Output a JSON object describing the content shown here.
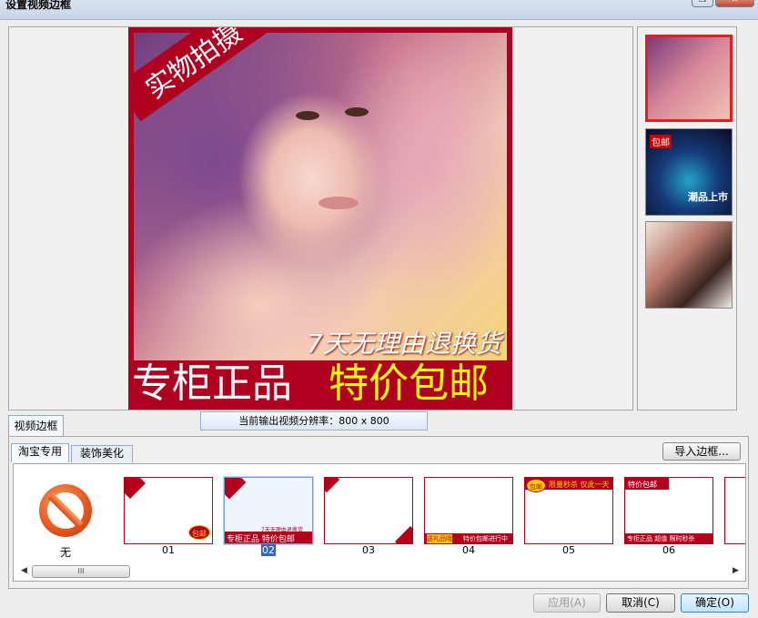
{
  "window": {
    "title": "设置视频边框",
    "restore_symbol": "❐",
    "close_symbol": "✕"
  },
  "preview": {
    "corner_tag": "实物拍摄",
    "slogan": "7天无理由退换货",
    "bar_left": "专柜正品",
    "bar_right": "特价包邮",
    "resolution_text": "当前输出视频分辨率：800 x 800",
    "frame_color": "#b0001f",
    "highlight_color": "#ffff00"
  },
  "thumbnails": {
    "items": [
      {
        "name": "thumb-1",
        "caption": ""
      },
      {
        "name": "thumb-2",
        "caption": "包邮"
      },
      {
        "name": "thumb-3",
        "caption": ""
      }
    ],
    "thumb2_overlay": "潮品上市"
  },
  "tabs": {
    "main": "视频边框",
    "sub": [
      "淘宝专用",
      "装饰美化"
    ]
  },
  "import_button": "导入边框...",
  "frames": {
    "none_label": "无",
    "items": [
      {
        "label": "01"
      },
      {
        "label": "02",
        "selected": true
      },
      {
        "label": "03"
      },
      {
        "label": "04"
      },
      {
        "label": "05"
      },
      {
        "label": "06"
      }
    ],
    "f02_bottom": "专柜正品 特价包邮",
    "f02_slogan": "7天无理由退换货",
    "f04_left": "送礼品哦",
    "f04_right": "特价包邮进行中",
    "f05_top": "限量秒杀 仅此一天",
    "f05_badge": "包邮",
    "f06_top": "特价包邮",
    "f06_bottom": "专柜正品  超值  限时秒杀",
    "f01_badge": "包邮"
  },
  "scrollbar": {
    "left_arrow": "◀",
    "right_arrow": "▶",
    "grip": "III"
  },
  "buttons": {
    "apply": "应用(A)",
    "cancel": "取消(C)",
    "ok": "确定(O)"
  }
}
